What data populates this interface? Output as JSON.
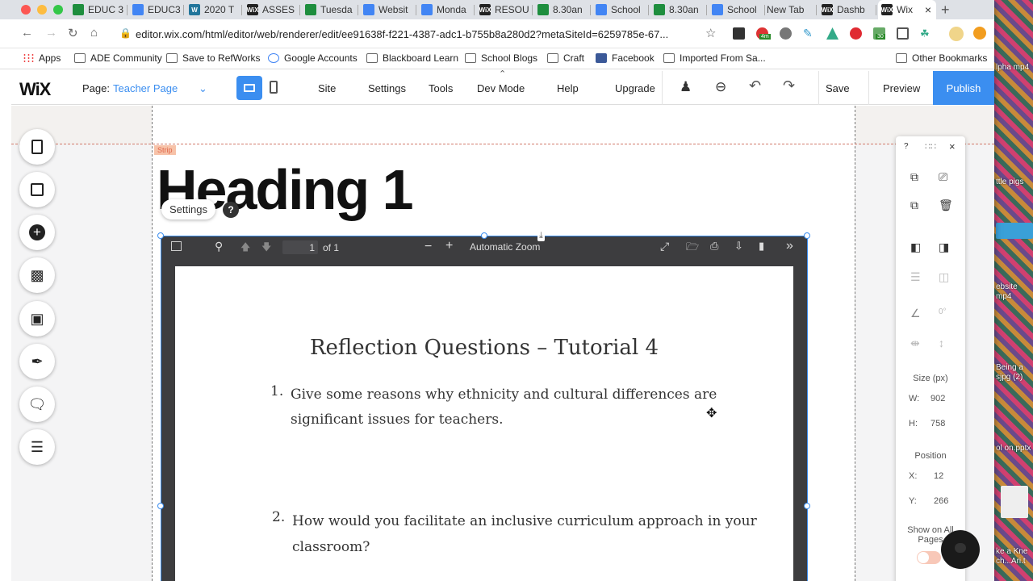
{
  "browser": {
    "tabs": [
      {
        "label": "EDUC 3",
        "icon": "google-drive-icon"
      },
      {
        "label": "EDUC3",
        "icon": "google-docs-icon"
      },
      {
        "label": "2020 T",
        "icon": "wordpress-icon"
      },
      {
        "label": "ASSES",
        "icon": "wix-icon"
      },
      {
        "label": "Tuesda",
        "icon": "google-drive-icon"
      },
      {
        "label": "Websit",
        "icon": "google-docs-icon"
      },
      {
        "label": "Monda",
        "icon": "google-docs-icon"
      },
      {
        "label": "RESOU",
        "icon": "wix-icon"
      },
      {
        "label": "8.30an",
        "icon": "google-drive-icon"
      },
      {
        "label": "School",
        "icon": "google-docs-icon"
      },
      {
        "label": "8.30an",
        "icon": "google-drive-icon"
      },
      {
        "label": "School",
        "icon": "google-docs-icon"
      },
      {
        "label": "New Tab",
        "icon": ""
      },
      {
        "label": "Dashb",
        "icon": "wix-icon"
      },
      {
        "label": "Wix",
        "icon": "wix-icon"
      }
    ],
    "new_tab": "+",
    "url": "editor.wix.com/html/editor/web/renderer/edit/ee91638f-f221-4387-adc1-b755b8a280d2?metaSiteId=6259785e-67...",
    "bookmarks": [
      "Apps",
      "ADE Community",
      "Save to RefWorks",
      "Google Accounts",
      "Blackboard Learn",
      "School Blogs",
      "Craft",
      "Facebook",
      "Imported From Sa..."
    ],
    "other_bookmarks": "Other Bookmarks",
    "ext_badges": [
      "4m",
      "30"
    ]
  },
  "editor": {
    "logo": "WiX",
    "page_label": "Page:",
    "page_name": "Teacher Page",
    "menu": [
      "Site",
      "Settings",
      "Tools",
      "Dev Mode",
      "Help",
      "Upgrade"
    ],
    "save": "Save",
    "preview": "Preview",
    "publish": "Publish",
    "strip_label": "Strip",
    "heading": "Heading 1",
    "settings_btn": "Settings",
    "help_btn": "?",
    "colors": {
      "publish": "#3b8ef0",
      "accent": "#3b8ef0",
      "strip": "#f5a07a"
    }
  },
  "pdf": {
    "page_num": "1",
    "page_of": "of 1",
    "zoom": "Automatic Zoom",
    "title": "Reflection Questions – Tutorial 4",
    "q1_num": "1.",
    "q1_text_a": "Give some reasons why ethnicity and cultural differences are",
    "q1_text_b": "significant issues for teachers.",
    "q2_num": "2.",
    "q2_text_a": "How would you facilitate an inclusive curriculum approach in your",
    "q2_text_b": "classroom?"
  },
  "panel": {
    "help": "?",
    "rotation": "0°",
    "size_label": "Size (px)",
    "w_label": "W:",
    "w_value": "902",
    "h_label": "H:",
    "h_value": "758",
    "pos_label": "Position",
    "x_label": "X:",
    "x_value": "12",
    "y_label": "Y:",
    "y_value": "266",
    "show_all": "Show on All Pages"
  },
  "desktop": {
    "files": [
      "lpha mp4",
      "ttle pigs",
      "ebsite mp4",
      "Being a sjpg (2)",
      "ol on.pptx",
      "ke a Kne ch...Ari.t"
    ]
  }
}
